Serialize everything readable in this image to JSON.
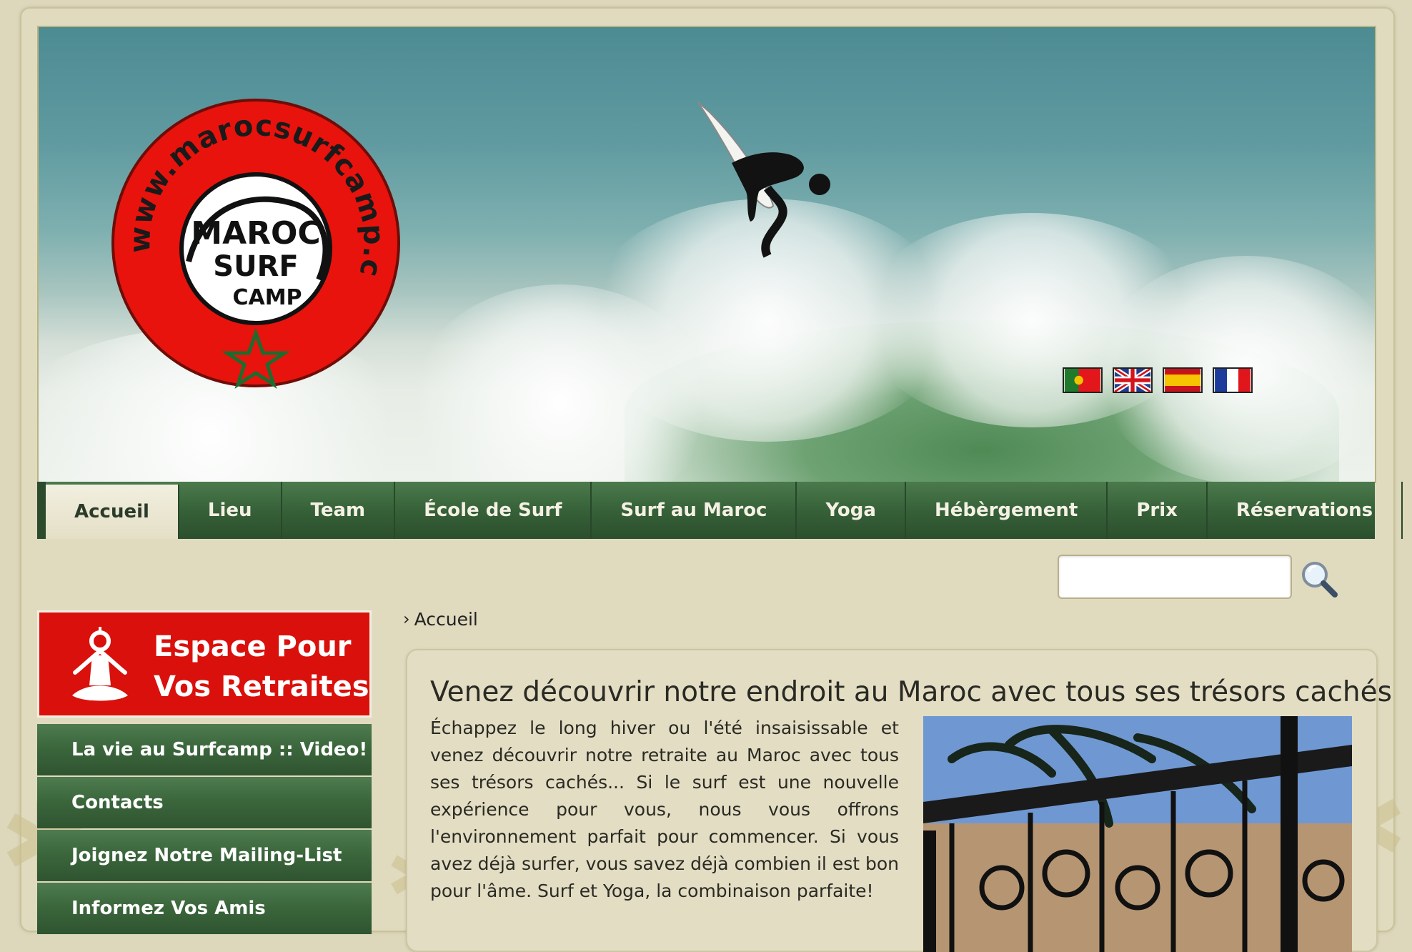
{
  "header": {
    "logo_text": "www.marocsurfcamp.com",
    "logo_inner": "MAROC SURF CAMP",
    "flags": [
      {
        "name": "portugal-flag",
        "alt": "Português"
      },
      {
        "name": "uk-flag",
        "alt": "English"
      },
      {
        "name": "spain-flag",
        "alt": "Español"
      },
      {
        "name": "france-flag",
        "alt": "Français"
      }
    ]
  },
  "nav": {
    "items": [
      {
        "label": "Accueil",
        "active": true
      },
      {
        "label": "Lieu"
      },
      {
        "label": "Team"
      },
      {
        "label": "École de Surf"
      },
      {
        "label": "Surf au Maroc"
      },
      {
        "label": "Yoga"
      },
      {
        "label": "Hébèrgement"
      },
      {
        "label": "Prix"
      },
      {
        "label": "Réservations"
      }
    ]
  },
  "search": {
    "placeholder": "",
    "icon": "magnifier-icon"
  },
  "sidebar": {
    "retreat_banner": "Espace Pour\nVos Retraites",
    "items": [
      {
        "label": "La vie au Surfcamp :: Video!"
      },
      {
        "label": "Contacts"
      },
      {
        "label": "Joignez Notre Mailing-List"
      },
      {
        "label": "Informez Vos Amis"
      }
    ]
  },
  "breadcrumb": {
    "label": "Accueil"
  },
  "content": {
    "title": "Venez découvrir notre endroit au Maroc avec tous ses trésors cachés",
    "body": "Échappez le long hiver ou l'été insaisissable et venez découvrir notre retraite au Maroc avec tous ses trésors cachés... Si le surf est une nouvelle expérience pour vous, nous vous offrons l'environnement parfait pour commencer. Si vous avez déjà surfer, vous savez déjà combien il est bon pour l'âme. Surf et Yoga, la combinaison parfaite!"
  },
  "colors": {
    "nav_green": "#355f37",
    "retreat_red": "#d9100b",
    "background": "#ddd7bb"
  }
}
